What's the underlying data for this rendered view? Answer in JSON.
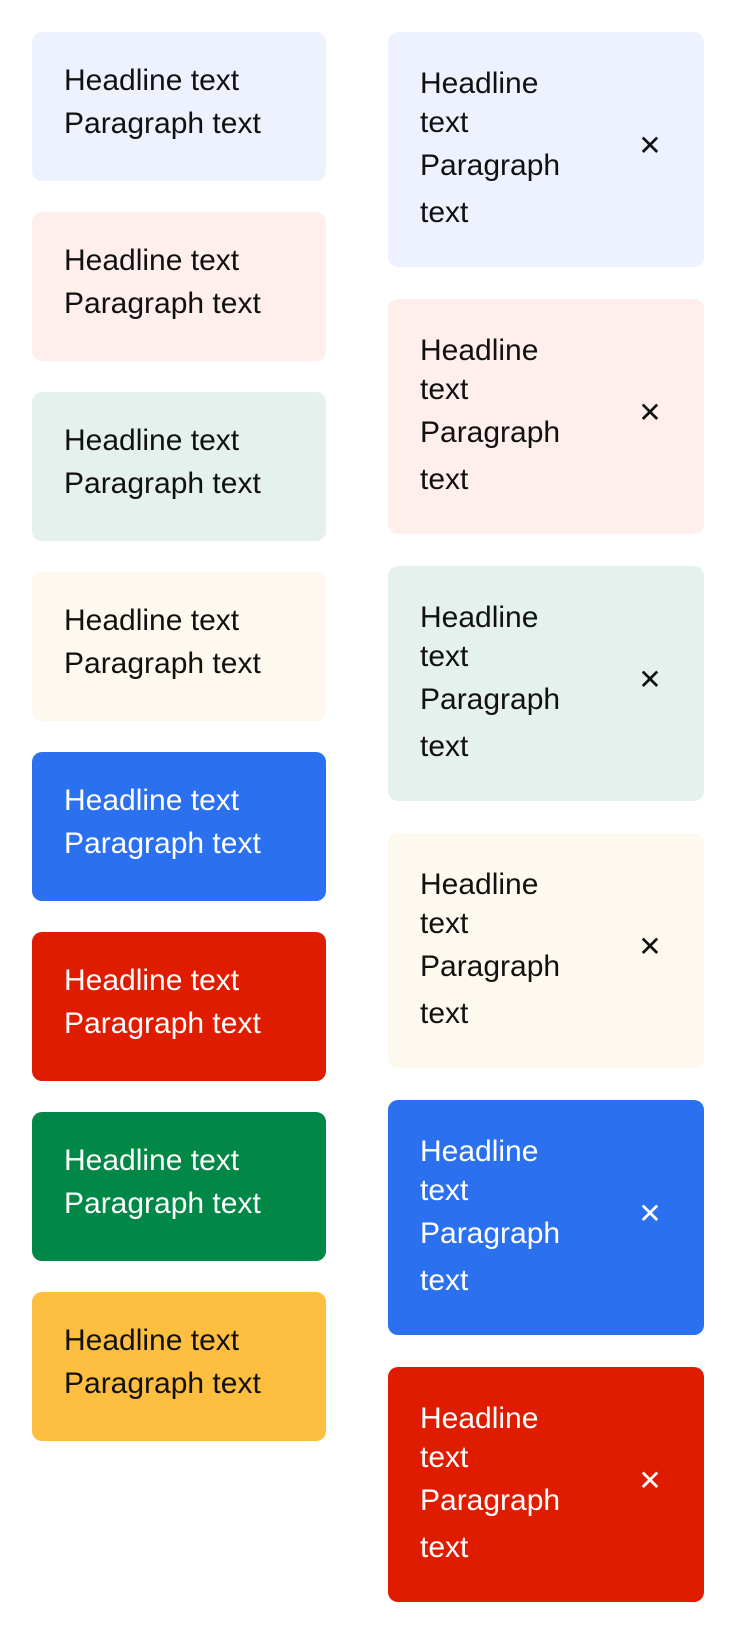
{
  "left_cards": [
    {
      "headline": "Headline text",
      "paragraph": "Paragraph text",
      "bg": "#edf2fe",
      "fg": "#111111"
    },
    {
      "headline": "Headline text",
      "paragraph": "Paragraph text",
      "bg": "#feeeec",
      "fg": "#111111"
    },
    {
      "headline": "Headline text",
      "paragraph": "Paragraph text",
      "bg": "#e5f1ec",
      "fg": "#111111"
    },
    {
      "headline": "Headline text",
      "paragraph": "Paragraph text",
      "bg": "#fef9ee",
      "fg": "#111111"
    },
    {
      "headline": "Headline text",
      "paragraph": "Paragraph text",
      "bg": "#2b70ef",
      "fg": "#ffffff"
    },
    {
      "headline": "Headline text",
      "paragraph": "Paragraph text",
      "bg": "#e01c00",
      "fg": "#ffffff"
    },
    {
      "headline": "Headline text",
      "paragraph": "Paragraph text",
      "bg": "#018746",
      "fg": "#ffffff"
    },
    {
      "headline": "Headline text",
      "paragraph": "Paragraph text",
      "bg": "#febf41",
      "fg": "#111111"
    }
  ],
  "right_cards": [
    {
      "headline": "Headline text",
      "paragraph": "Paragraph text",
      "close": "✕",
      "bg": "#edf2fe",
      "fg": "#111111"
    },
    {
      "headline": "Headline text",
      "paragraph": "Paragraph text",
      "close": "✕",
      "bg": "#feeeec",
      "fg": "#111111"
    },
    {
      "headline": "Headline text",
      "paragraph": "Paragraph text",
      "close": "✕",
      "bg": "#e5f1ec",
      "fg": "#111111"
    },
    {
      "headline": "Headline text",
      "paragraph": "Paragraph text",
      "close": "✕",
      "bg": "#fef9ee",
      "fg": "#111111"
    },
    {
      "headline": "Headline text",
      "paragraph": "Paragraph text",
      "close": "✕",
      "bg": "#2b70ef",
      "fg": "#ffffff"
    },
    {
      "headline": "Headline text",
      "paragraph": "Paragraph text",
      "close": "✕",
      "bg": "#e01c00",
      "fg": "#ffffff"
    }
  ]
}
